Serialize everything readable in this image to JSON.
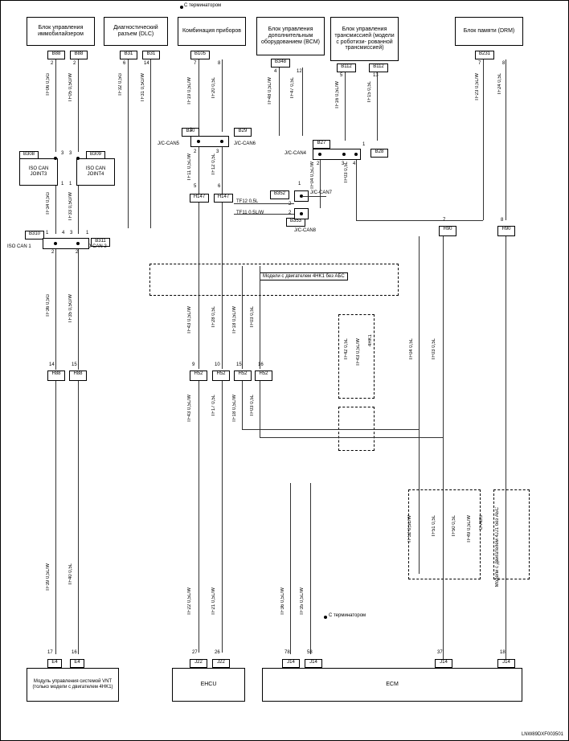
{
  "top_label_left": "С терминатором",
  "top_label_right": "С терминатором",
  "modules": {
    "immobilizer": "Блок управления иммобилайзером",
    "diag": "Диагностический разъем (DLC)",
    "combo": "Комбинация приборов",
    "bcm": "Блок управления дополнительным оборудованием (BCM)",
    "tcm": "Блок управления трансмиссией (модели с роботизи-\nрованной трансмиссией)",
    "drm": "Блок памяти (DRM)",
    "ehcu": "EHCU",
    "ecm": "ECM",
    "vnt": "Модуль управления системой VNT\n(только модели с двигателем 4HK1)"
  },
  "conns": {
    "b88a": "B88",
    "b88b": "B88",
    "b31a": "B31",
    "b31b": "B31",
    "b105": "B105",
    "b348": "B348",
    "b112a": "B112",
    "b112b": "B112",
    "b231": "B231",
    "b30": "B30",
    "b29": "B29",
    "b27": "B27",
    "b28": "B28",
    "h147a": "H147",
    "h147b": "H147",
    "b352": "B352",
    "b353": "B353",
    "h90a": "H90",
    "h90b": "H90",
    "b308": "B308",
    "b309": "B309",
    "b310": "B310",
    "b311": "B311",
    "h88a": "H88",
    "h88b": "H88",
    "h52a": "H52",
    "h52b": "H52",
    "h52c": "H52",
    "h52d": "H52",
    "e4a": "E4",
    "e4b": "E4",
    "j22a": "J22",
    "j22b": "J22",
    "j14a": "J14",
    "j14b": "J14",
    "j14c": "J14",
    "j14d": "J14"
  },
  "jc": {
    "can5": "J/C-CAN5",
    "can6": "J/C-CAN6",
    "can1": "ISO CAN 1",
    "can2": "ISO CAN 2",
    "can4": "J/C-CAN4",
    "can7": "J/C-CAN7",
    "can8": "J/C-CAN8",
    "iso3": "ISO CAN JOINT3",
    "iso4": "ISO CAN JOINT4"
  },
  "wires": {
    "tf06": "TF06 0,5G",
    "tf05": "TF05 0,5G/W",
    "tf32": "TF32 0,5G",
    "tf31": "TF31 0,5G/W",
    "tf19": "TF19 0,5L/W",
    "tf20": "TF20 0,5L",
    "tf48": "TF48 0,5L/W",
    "tf47": "TF47 0,5L",
    "tf16": "TF16 0,5L/W",
    "tf15": "TF15 0,5L",
    "tf23": "TF23 0,5L/W",
    "tf24": "TF24 0,5L",
    "tf11": "TF11 0,5L/W",
    "tf12b": "TF12 0,5L",
    "tf04a": "TF04 0,5L/W",
    "tf03a": "TF03 0,5L",
    "tf12": "TF12 0,5L",
    "tf11b": "TF11 0,5L/W",
    "tf34": "TF34 0,5G",
    "tf33": "TF33 0,5G/W",
    "tf36": "TF36 0,5G",
    "tf35": "TF35 0,5G/W",
    "tf43": "TF43 0,5L/W",
    "tf28": "TF28 0,5L",
    "tf18": "TF18 0,5L/W",
    "tf03": "TF03 0,5L",
    "tf43b": "TF43 0,5L/W",
    "tf17": "TF17 0,5L",
    "tf18b": "TF18 0,5L/W",
    "tf03b": "TF03 0,5L",
    "tf42": "TF42 0,5L",
    "tf43c": "TF43 0,5L/W",
    "tf04": "TF04 0,5L",
    "tf03c": "TF03 0,5L",
    "tf39": "TF39 0,5L/W",
    "tf40": "TF40 0,5L",
    "tf22": "TF22 0,5L/W",
    "tf21": "TF21 0,5L/W",
    "tf36b": "TF36 0,5L/W",
    "tf35b": "TF35 0,5L/W",
    "tf52": "TF52 0,5L/W",
    "tf51": "TF51 0,5L",
    "tf50": "TF50 0,5L",
    "tf49": "TF49 0,5L/W",
    "cabs": "C-ABS",
    "4hk1": "4HK1"
  },
  "notes": {
    "abs4hk1": "Модели с двигателем 4HK1 без АБС",
    "abs4jj1": "Модели с двигателем 4JJ1 без АБС"
  },
  "doc": "LNW89DXF003501",
  "pins": {
    "p1": "1",
    "p2": "2",
    "p3": "3",
    "p4": "4",
    "p5": "5",
    "p6": "6",
    "p7": "7",
    "p8": "8",
    "p9": "9",
    "p10": "10",
    "p12": "12",
    "p13": "13",
    "p14": "14",
    "p15": "15",
    "p16": "16",
    "p17": "17",
    "p18": "18",
    "p26": "26",
    "p27": "27",
    "p37": "37",
    "p58": "58",
    "p78": "78"
  }
}
